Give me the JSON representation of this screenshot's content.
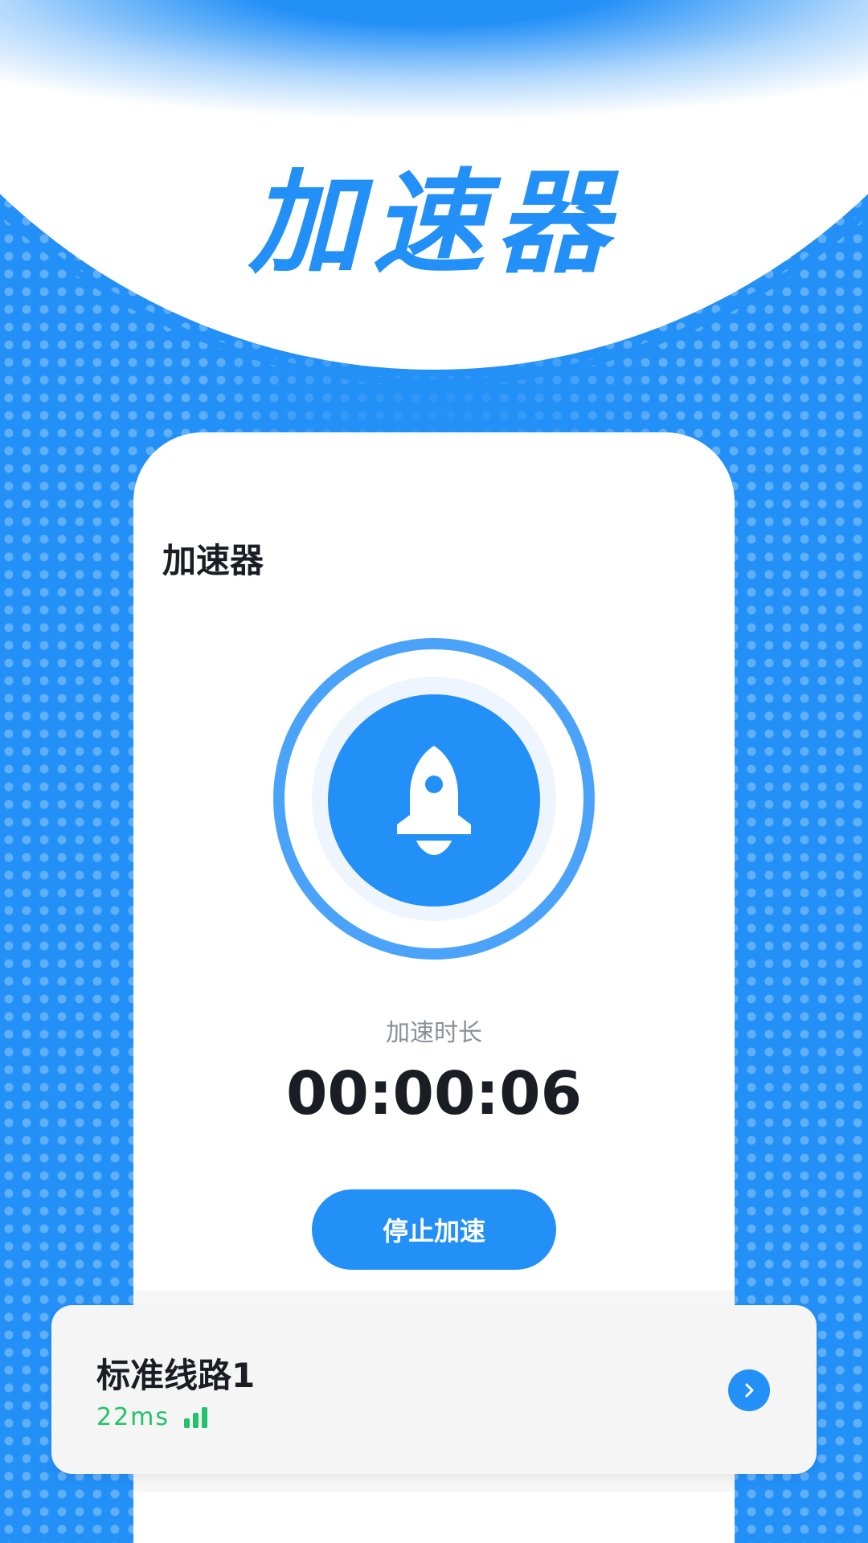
{
  "header": {
    "title": "加速器"
  },
  "card": {
    "title": "加速器",
    "duration_label": "加速时长",
    "timer": "00:00:06",
    "stop_button": "停止加速",
    "rocket_icon": "rocket-icon"
  },
  "route": {
    "name": "标准线路1",
    "ping": "22ms",
    "signal_icon": "signal-bars-icon",
    "arrow_icon": "chevron-right-icon"
  },
  "colors": {
    "primary": "#2390f7",
    "ping_green": "#22c26b",
    "text_dark": "#1a1d24",
    "text_gray": "#8a8f98"
  }
}
